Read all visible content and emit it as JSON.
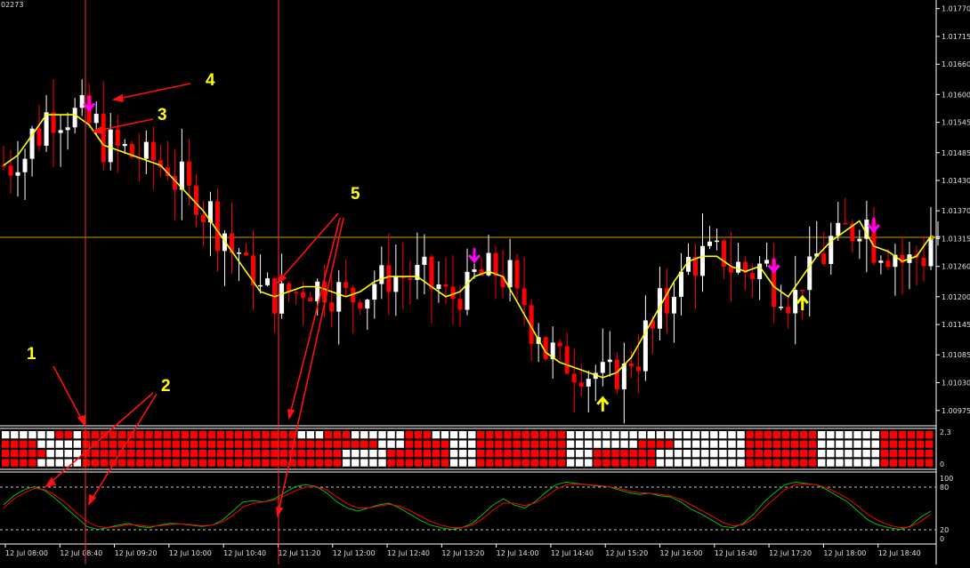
{
  "chart_data": [
    {
      "type": "candlestick",
      "header_value": "02273",
      "ylim": [
        1.0095,
        1.0178
      ],
      "y_ticks": [
        "1.01770",
        "1.01715",
        "1.01660",
        "1.01600",
        "1.01545",
        "1.01485",
        "1.01430",
        "1.01370",
        "1.01315",
        "1.01260",
        "1.01200",
        "1.01145",
        "1.01085",
        "1.01030",
        "1.00975"
      ],
      "horizontal_level": 1.01325,
      "ma_series": [
        1.0146,
        1.0148,
        1.0152,
        1.0156,
        1.0156,
        1.0156,
        1.0154,
        1.015,
        1.0149,
        1.0148,
        1.0147,
        1.0146,
        1.0143,
        1.014,
        1.0137,
        1.0133,
        1.0129,
        1.0125,
        1.0121,
        1.012,
        1.0121,
        1.0122,
        1.0122,
        1.0121,
        1.012,
        1.0121,
        1.0123,
        1.0124,
        1.0124,
        1.0124,
        1.0122,
        1.012,
        1.0121,
        1.0124,
        1.0125,
        1.0124,
        1.0119,
        1.0114,
        1.0109,
        1.0107,
        1.0106,
        1.0105,
        1.0104,
        1.0105,
        1.0108,
        1.0113,
        1.0118,
        1.0123,
        1.0127,
        1.0128,
        1.0128,
        1.0126,
        1.0125,
        1.0126,
        1.0122,
        1.012,
        1.0124,
        1.0128,
        1.0131,
        1.0133,
        1.0135,
        1.013,
        1.0129,
        1.0127,
        1.0128,
        1.0132
      ]
    },
    {
      "type": "heatmap",
      "ylabels": [
        "2.3",
        "0"
      ],
      "rows": 4,
      "red_runs": [
        [
          [
            6,
            7
          ],
          [
            9,
            32
          ],
          [
            36,
            38
          ],
          [
            45,
            47
          ],
          [
            53,
            62
          ],
          [
            83,
            90
          ],
          [
            98,
            103
          ]
        ],
        [
          [
            0,
            3
          ],
          [
            9,
            41
          ],
          [
            45,
            49
          ],
          [
            53,
            62
          ],
          [
            71,
            74
          ],
          [
            83,
            90
          ],
          [
            98,
            103
          ]
        ],
        [
          [
            0,
            4
          ],
          [
            9,
            37
          ],
          [
            43,
            49
          ],
          [
            53,
            62
          ],
          [
            66,
            72
          ],
          [
            83,
            90
          ],
          [
            98,
            103
          ]
        ],
        [
          [
            0,
            3
          ],
          [
            9,
            37
          ],
          [
            43,
            49
          ],
          [
            53,
            62
          ],
          [
            66,
            72
          ],
          [
            83,
            90
          ],
          [
            98,
            103
          ]
        ]
      ]
    },
    {
      "type": "line",
      "ylim": [
        0,
        100
      ],
      "y_ticks": [
        "100",
        "80",
        "20",
        "0"
      ],
      "levels": [
        80,
        20
      ],
      "x_ticks": [
        "12 Jul 08:00",
        "12 Jul 08:40",
        "12 Jul 09:20",
        "12 Jul 10:00",
        "12 Jul 10:40",
        "12 Jul 11:20",
        "12 Jul 12:00",
        "12 Jul 12:40",
        "12 Jul 13:20",
        "12 Jul 14:00",
        "12 Jul 14:40",
        "12 Jul 15:20",
        "12 Jul 16:00",
        "12 Jul 16:40",
        "12 Jul 17:20",
        "12 Jul 18:00",
        "12 Jul 18:40"
      ],
      "series": [
        {
          "color": "#00c000",
          "values": [
            55,
            70,
            80,
            85,
            78,
            65,
            50,
            35,
            20,
            15,
            18,
            22,
            25,
            20,
            18,
            22,
            25,
            24,
            22,
            20,
            22,
            30,
            45,
            60,
            62,
            60,
            65,
            75,
            85,
            88,
            85,
            75,
            60,
            50,
            45,
            50,
            55,
            58,
            50,
            40,
            30,
            22,
            18,
            15,
            18,
            25,
            40,
            55,
            65,
            55,
            50,
            60,
            75,
            88,
            92,
            90,
            88,
            86,
            85,
            80,
            75,
            72,
            74,
            70,
            68,
            60,
            48,
            40,
            30,
            20,
            18,
            25,
            40,
            60,
            75,
            88,
            92,
            90,
            88,
            80,
            70,
            60,
            45,
            30,
            22,
            18,
            15,
            20,
            35,
            45
          ]
        },
        {
          "color": "#ff0000",
          "values": [
            50,
            65,
            75,
            82,
            80,
            70,
            58,
            42,
            28,
            20,
            18,
            20,
            23,
            22,
            20,
            21,
            23,
            24,
            23,
            21,
            22,
            27,
            38,
            52,
            58,
            60,
            63,
            70,
            78,
            84,
            85,
            80,
            68,
            57,
            50,
            50,
            53,
            56,
            53,
            46,
            37,
            28,
            22,
            18,
            18,
            22,
            33,
            47,
            58,
            58,
            54,
            58,
            68,
            80,
            88,
            89,
            88,
            87,
            85,
            82,
            78,
            75,
            74,
            72,
            70,
            64,
            55,
            46,
            37,
            27,
            21,
            23,
            33,
            50,
            65,
            80,
            88,
            89,
            88,
            83,
            75,
            66,
            53,
            39,
            29,
            22,
            18,
            19,
            28,
            40
          ]
        }
      ]
    }
  ],
  "annotations": {
    "labels": [
      "1",
      "2",
      "3",
      "4",
      "5"
    ]
  },
  "colors": {
    "background": "#000000",
    "bull": "#ffffff",
    "bear": "#ff0000",
    "ma": "#ffff00",
    "label": "#ffff00",
    "sell_arrow": "#ff00ff",
    "buy_arrow": "#ffff00",
    "level_line": "#c8a000",
    "axis": "#ffffff",
    "cursor": "#ff3030"
  }
}
